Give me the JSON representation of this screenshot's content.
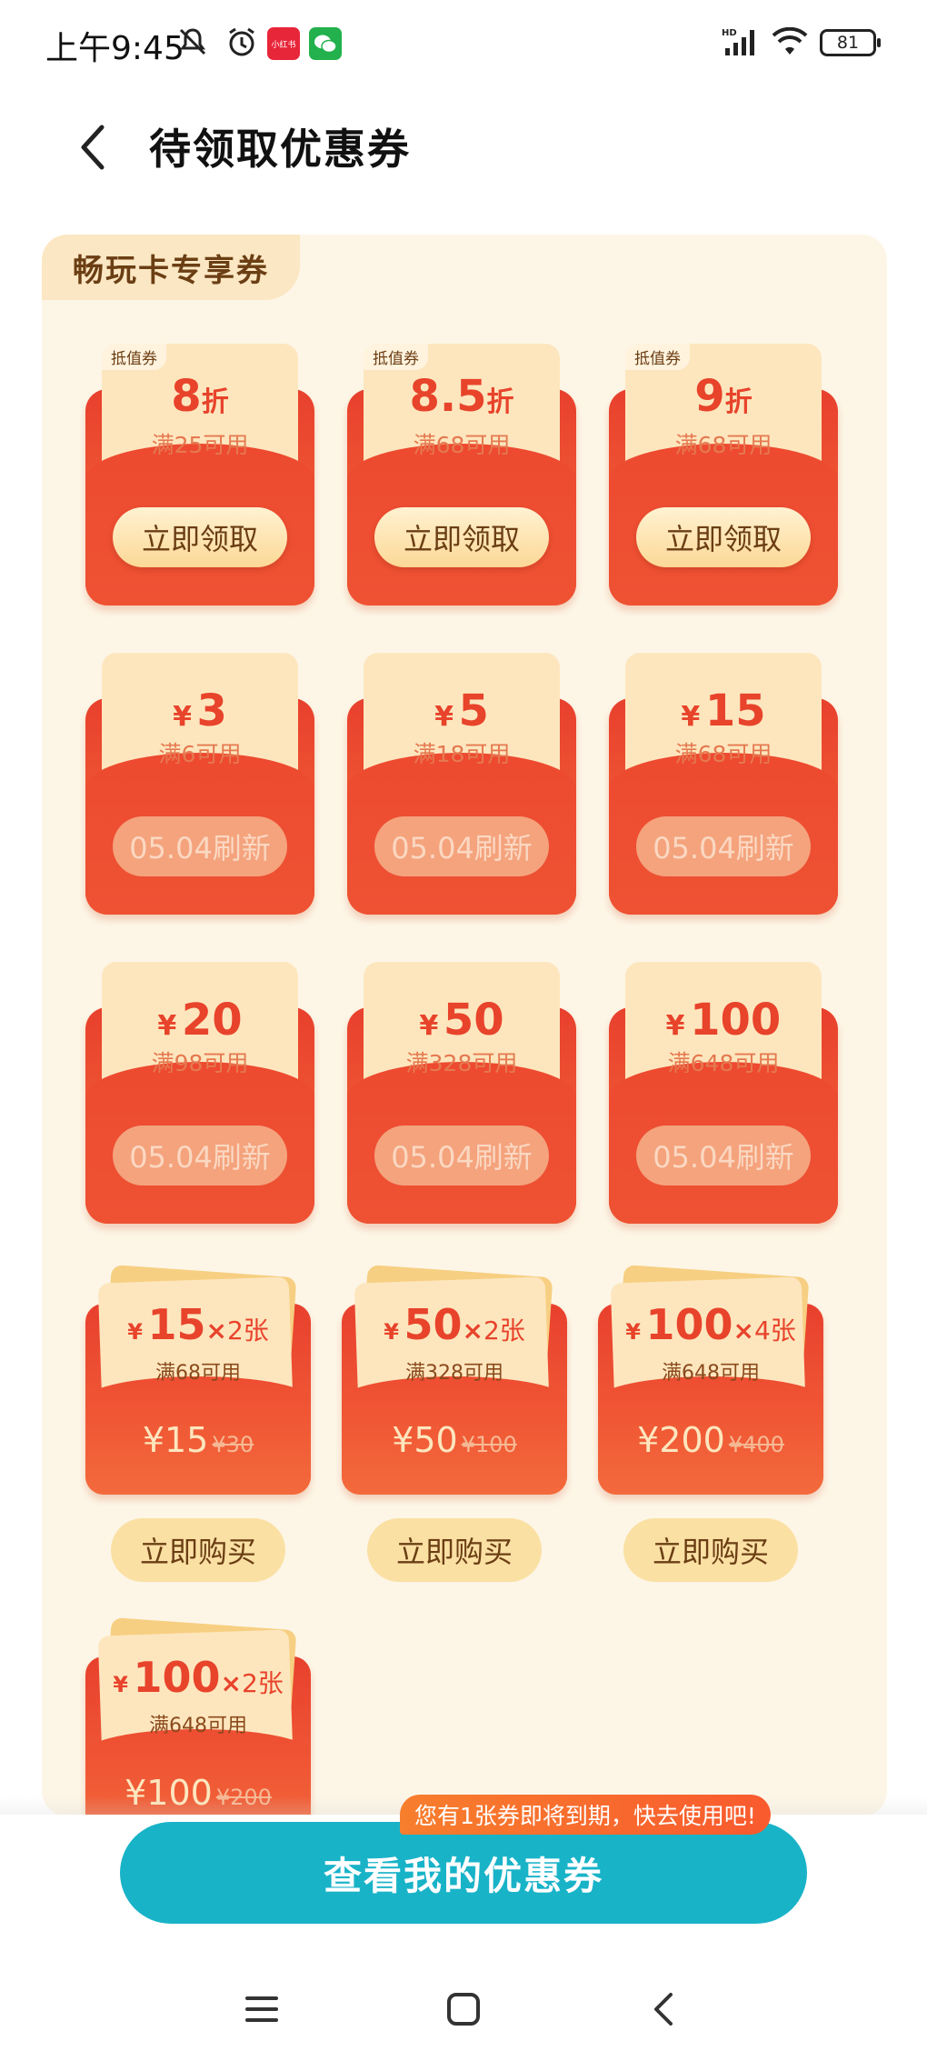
{
  "status_bar": {
    "time": "上午9:45",
    "app_badge": "小红书",
    "battery": "81"
  },
  "header": {
    "title": "待领取优惠券"
  },
  "panel": {
    "tab_label": "畅玩卡专享券"
  },
  "discount_coupons": [
    {
      "label": "抵值券",
      "value": "8",
      "unit": "折",
      "condition": "满25可用",
      "button": "立即领取"
    },
    {
      "label": "抵值券",
      "value": "8.5",
      "unit": "折",
      "condition": "满68可用",
      "button": "立即领取"
    },
    {
      "label": "抵值券",
      "value": "9",
      "unit": "折",
      "condition": "满68可用",
      "button": "立即领取"
    }
  ],
  "cash_coupons": [
    {
      "currency": "¥",
      "value": "3",
      "condition": "满6可用",
      "status": "05.04刷新"
    },
    {
      "currency": "¥",
      "value": "5",
      "condition": "满18可用",
      "status": "05.04刷新"
    },
    {
      "currency": "¥",
      "value": "15",
      "condition": "满68可用",
      "status": "05.04刷新"
    },
    {
      "currency": "¥",
      "value": "20",
      "condition": "满98可用",
      "status": "05.04刷新"
    },
    {
      "currency": "¥",
      "value": "50",
      "condition": "满328可用",
      "status": "05.04刷新"
    },
    {
      "currency": "¥",
      "value": "100",
      "condition": "满648可用",
      "status": "05.04刷新"
    }
  ],
  "packs": [
    {
      "currency": "¥",
      "value": "15",
      "times": "×",
      "count": "2张",
      "condition": "满68可用",
      "price": "¥15",
      "original": "¥30",
      "button": "立即购买"
    },
    {
      "currency": "¥",
      "value": "50",
      "times": "×",
      "count": "2张",
      "condition": "满328可用",
      "price": "¥50",
      "original": "¥100",
      "button": "立即购买"
    },
    {
      "currency": "¥",
      "value": "100",
      "times": "×",
      "count": "4张",
      "condition": "满648可用",
      "price": "¥200",
      "original": "¥400",
      "button": "立即购买"
    },
    {
      "currency": "¥",
      "value": "100",
      "times": "×",
      "count": "2张",
      "condition": "满648可用",
      "price": "¥100",
      "original": "¥200"
    }
  ],
  "bottom": {
    "expire_tip": "您有1张券即将到期，快去使用吧!",
    "view_button": "查看我的优惠券"
  },
  "colors": {
    "accent_red": "#e8402d",
    "teal_button": "#19b3c8",
    "panel_bg": "#fdf6e7"
  }
}
